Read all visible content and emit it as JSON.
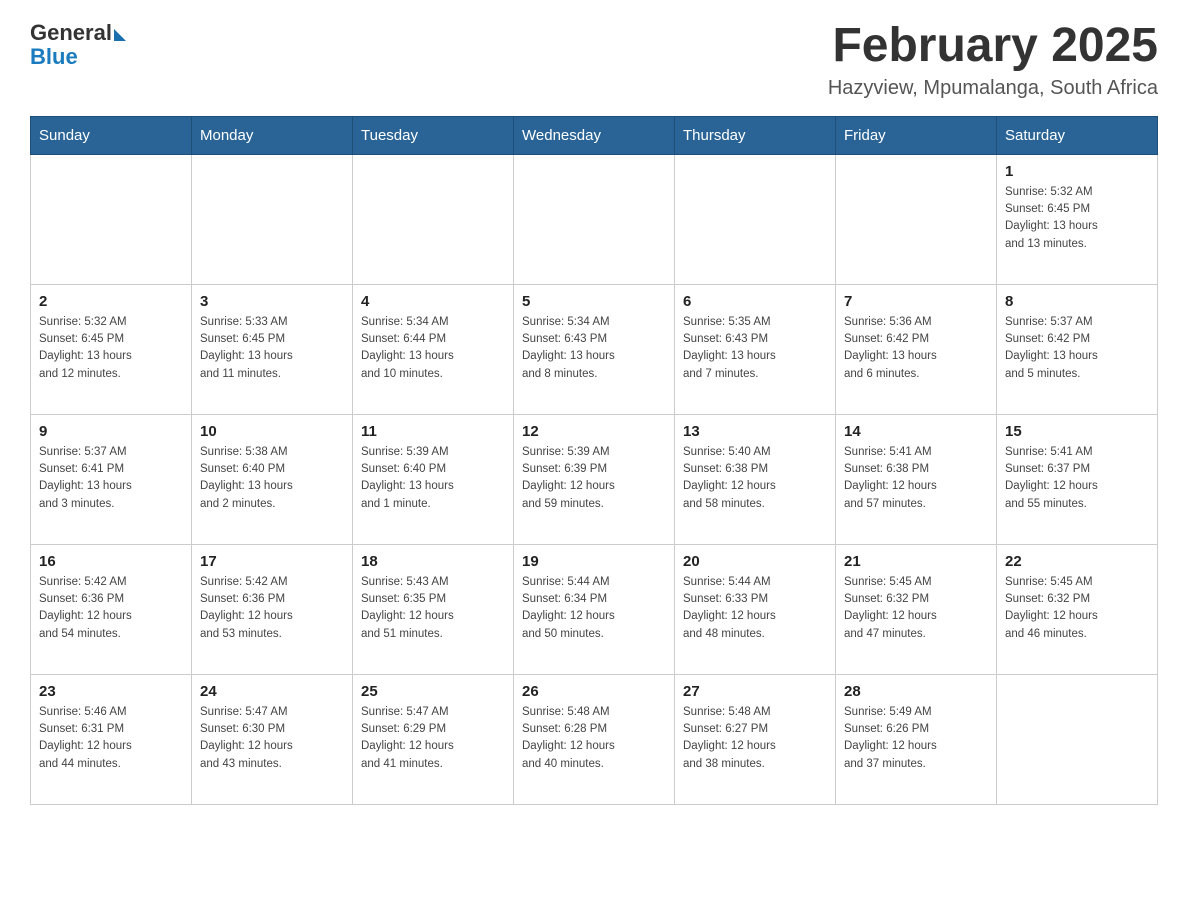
{
  "header": {
    "logo_general": "General",
    "logo_blue": "Blue",
    "month_title": "February 2025",
    "location": "Hazyview, Mpumalanga, South Africa"
  },
  "weekdays": [
    "Sunday",
    "Monday",
    "Tuesday",
    "Wednesday",
    "Thursday",
    "Friday",
    "Saturday"
  ],
  "weeks": [
    [
      {
        "day": "",
        "info": ""
      },
      {
        "day": "",
        "info": ""
      },
      {
        "day": "",
        "info": ""
      },
      {
        "day": "",
        "info": ""
      },
      {
        "day": "",
        "info": ""
      },
      {
        "day": "",
        "info": ""
      },
      {
        "day": "1",
        "info": "Sunrise: 5:32 AM\nSunset: 6:45 PM\nDaylight: 13 hours\nand 13 minutes."
      }
    ],
    [
      {
        "day": "2",
        "info": "Sunrise: 5:32 AM\nSunset: 6:45 PM\nDaylight: 13 hours\nand 12 minutes."
      },
      {
        "day": "3",
        "info": "Sunrise: 5:33 AM\nSunset: 6:45 PM\nDaylight: 13 hours\nand 11 minutes."
      },
      {
        "day": "4",
        "info": "Sunrise: 5:34 AM\nSunset: 6:44 PM\nDaylight: 13 hours\nand 10 minutes."
      },
      {
        "day": "5",
        "info": "Sunrise: 5:34 AM\nSunset: 6:43 PM\nDaylight: 13 hours\nand 8 minutes."
      },
      {
        "day": "6",
        "info": "Sunrise: 5:35 AM\nSunset: 6:43 PM\nDaylight: 13 hours\nand 7 minutes."
      },
      {
        "day": "7",
        "info": "Sunrise: 5:36 AM\nSunset: 6:42 PM\nDaylight: 13 hours\nand 6 minutes."
      },
      {
        "day": "8",
        "info": "Sunrise: 5:37 AM\nSunset: 6:42 PM\nDaylight: 13 hours\nand 5 minutes."
      }
    ],
    [
      {
        "day": "9",
        "info": "Sunrise: 5:37 AM\nSunset: 6:41 PM\nDaylight: 13 hours\nand 3 minutes."
      },
      {
        "day": "10",
        "info": "Sunrise: 5:38 AM\nSunset: 6:40 PM\nDaylight: 13 hours\nand 2 minutes."
      },
      {
        "day": "11",
        "info": "Sunrise: 5:39 AM\nSunset: 6:40 PM\nDaylight: 13 hours\nand 1 minute."
      },
      {
        "day": "12",
        "info": "Sunrise: 5:39 AM\nSunset: 6:39 PM\nDaylight: 12 hours\nand 59 minutes."
      },
      {
        "day": "13",
        "info": "Sunrise: 5:40 AM\nSunset: 6:38 PM\nDaylight: 12 hours\nand 58 minutes."
      },
      {
        "day": "14",
        "info": "Sunrise: 5:41 AM\nSunset: 6:38 PM\nDaylight: 12 hours\nand 57 minutes."
      },
      {
        "day": "15",
        "info": "Sunrise: 5:41 AM\nSunset: 6:37 PM\nDaylight: 12 hours\nand 55 minutes."
      }
    ],
    [
      {
        "day": "16",
        "info": "Sunrise: 5:42 AM\nSunset: 6:36 PM\nDaylight: 12 hours\nand 54 minutes."
      },
      {
        "day": "17",
        "info": "Sunrise: 5:42 AM\nSunset: 6:36 PM\nDaylight: 12 hours\nand 53 minutes."
      },
      {
        "day": "18",
        "info": "Sunrise: 5:43 AM\nSunset: 6:35 PM\nDaylight: 12 hours\nand 51 minutes."
      },
      {
        "day": "19",
        "info": "Sunrise: 5:44 AM\nSunset: 6:34 PM\nDaylight: 12 hours\nand 50 minutes."
      },
      {
        "day": "20",
        "info": "Sunrise: 5:44 AM\nSunset: 6:33 PM\nDaylight: 12 hours\nand 48 minutes."
      },
      {
        "day": "21",
        "info": "Sunrise: 5:45 AM\nSunset: 6:32 PM\nDaylight: 12 hours\nand 47 minutes."
      },
      {
        "day": "22",
        "info": "Sunrise: 5:45 AM\nSunset: 6:32 PM\nDaylight: 12 hours\nand 46 minutes."
      }
    ],
    [
      {
        "day": "23",
        "info": "Sunrise: 5:46 AM\nSunset: 6:31 PM\nDaylight: 12 hours\nand 44 minutes."
      },
      {
        "day": "24",
        "info": "Sunrise: 5:47 AM\nSunset: 6:30 PM\nDaylight: 12 hours\nand 43 minutes."
      },
      {
        "day": "25",
        "info": "Sunrise: 5:47 AM\nSunset: 6:29 PM\nDaylight: 12 hours\nand 41 minutes."
      },
      {
        "day": "26",
        "info": "Sunrise: 5:48 AM\nSunset: 6:28 PM\nDaylight: 12 hours\nand 40 minutes."
      },
      {
        "day": "27",
        "info": "Sunrise: 5:48 AM\nSunset: 6:27 PM\nDaylight: 12 hours\nand 38 minutes."
      },
      {
        "day": "28",
        "info": "Sunrise: 5:49 AM\nSunset: 6:26 PM\nDaylight: 12 hours\nand 37 minutes."
      },
      {
        "day": "",
        "info": ""
      }
    ]
  ]
}
